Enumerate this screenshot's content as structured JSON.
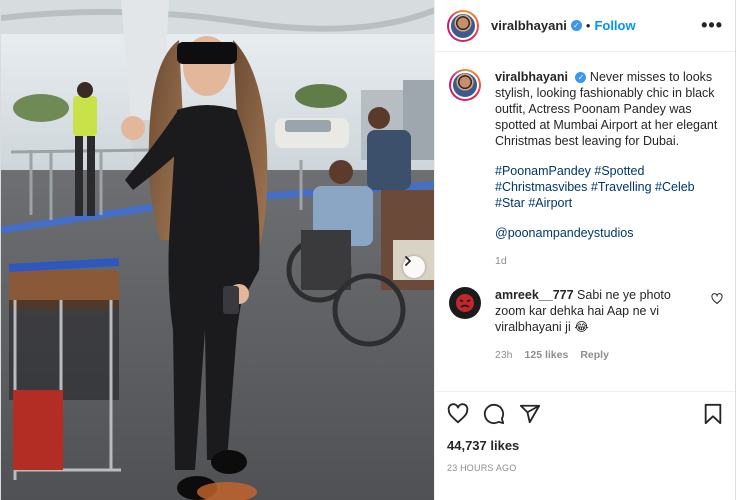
{
  "post": {
    "author": "viralbhayani",
    "follow_label": "Follow",
    "more_label": "•••",
    "dot": "•"
  },
  "caption": {
    "username": "viralbhayani",
    "text": "Never misses to looks stylish, looking fashionably chic in black outfit, Actress Poonam Pandey was spotted at Mumbai Airport at her elegant Christmas best leaving for Dubai.",
    "hashtags": "#PoonamPandey #Spotted #Christmasvibes #Travelling #Celeb #Star #Airport",
    "mention": "@poonampandeystudios",
    "age": "1d"
  },
  "comment": {
    "username": "amreek__777",
    "text": "Sabi ne ye photo zoom kar dehka hai Aap ne vi viralbhayani ji",
    "emoji": "😂",
    "age": "23h",
    "likes": "125 likes",
    "reply_label": "Reply"
  },
  "likes_count": "44,737 likes",
  "timestamp": "23 HOURS AGO",
  "icons": {
    "like": "heart-icon",
    "comment": "comment-icon",
    "share": "share-icon",
    "save": "bookmark-icon",
    "next": "chevron-right-icon",
    "comment_like": "heart-icon"
  },
  "colors": {
    "link": "#00376b",
    "follow": "#0095f6",
    "verified": "#3897f0",
    "muted": "#8e8e8e"
  }
}
